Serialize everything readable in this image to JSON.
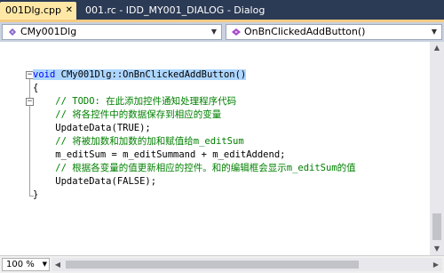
{
  "tabs": {
    "active": {
      "label": "001Dlg.cpp",
      "close_glyph": "✕"
    },
    "inactive": {
      "label": "001.rc - IDD_MY001_DIALOG - Dialog"
    }
  },
  "navbar": {
    "class_combo": {
      "value": "CMy001Dlg",
      "icon": "class-icon"
    },
    "member_combo": {
      "value": "OnBnClickedAddButton()",
      "icon": "method-icon"
    }
  },
  "code": {
    "fold_minus": "−",
    "lines": [
      {
        "kw": "void",
        "text": " CMy001Dlg::OnBnClickedAddButton()"
      },
      {
        "text": "{"
      },
      {
        "comment": "    // TODO: 在此添加控件通知处理程序代码"
      },
      {
        "comment": "    // 将各控件中的数据保存到相应的变量"
      },
      {
        "text": "    UpdateData(TRUE);"
      },
      {
        "comment": "    // 将被加数和加数的加和赋值给m_editSum"
      },
      {
        "text": "    m_editSum = m_editSummand + m_editAddend;"
      },
      {
        "comment": "    // 根据各变量的值更新相应的控件。和的编辑框会显示m_editSum的值"
      },
      {
        "text": "    UpdateData(FALSE);"
      },
      {
        "text": "}"
      }
    ]
  },
  "status": {
    "zoom": "100 %"
  },
  "colors": {
    "keyword": "#0000ff",
    "comment": "#008000",
    "selection": "#add6ff",
    "tab_active": "#ffe8a6",
    "frame": "#2b3a55"
  }
}
